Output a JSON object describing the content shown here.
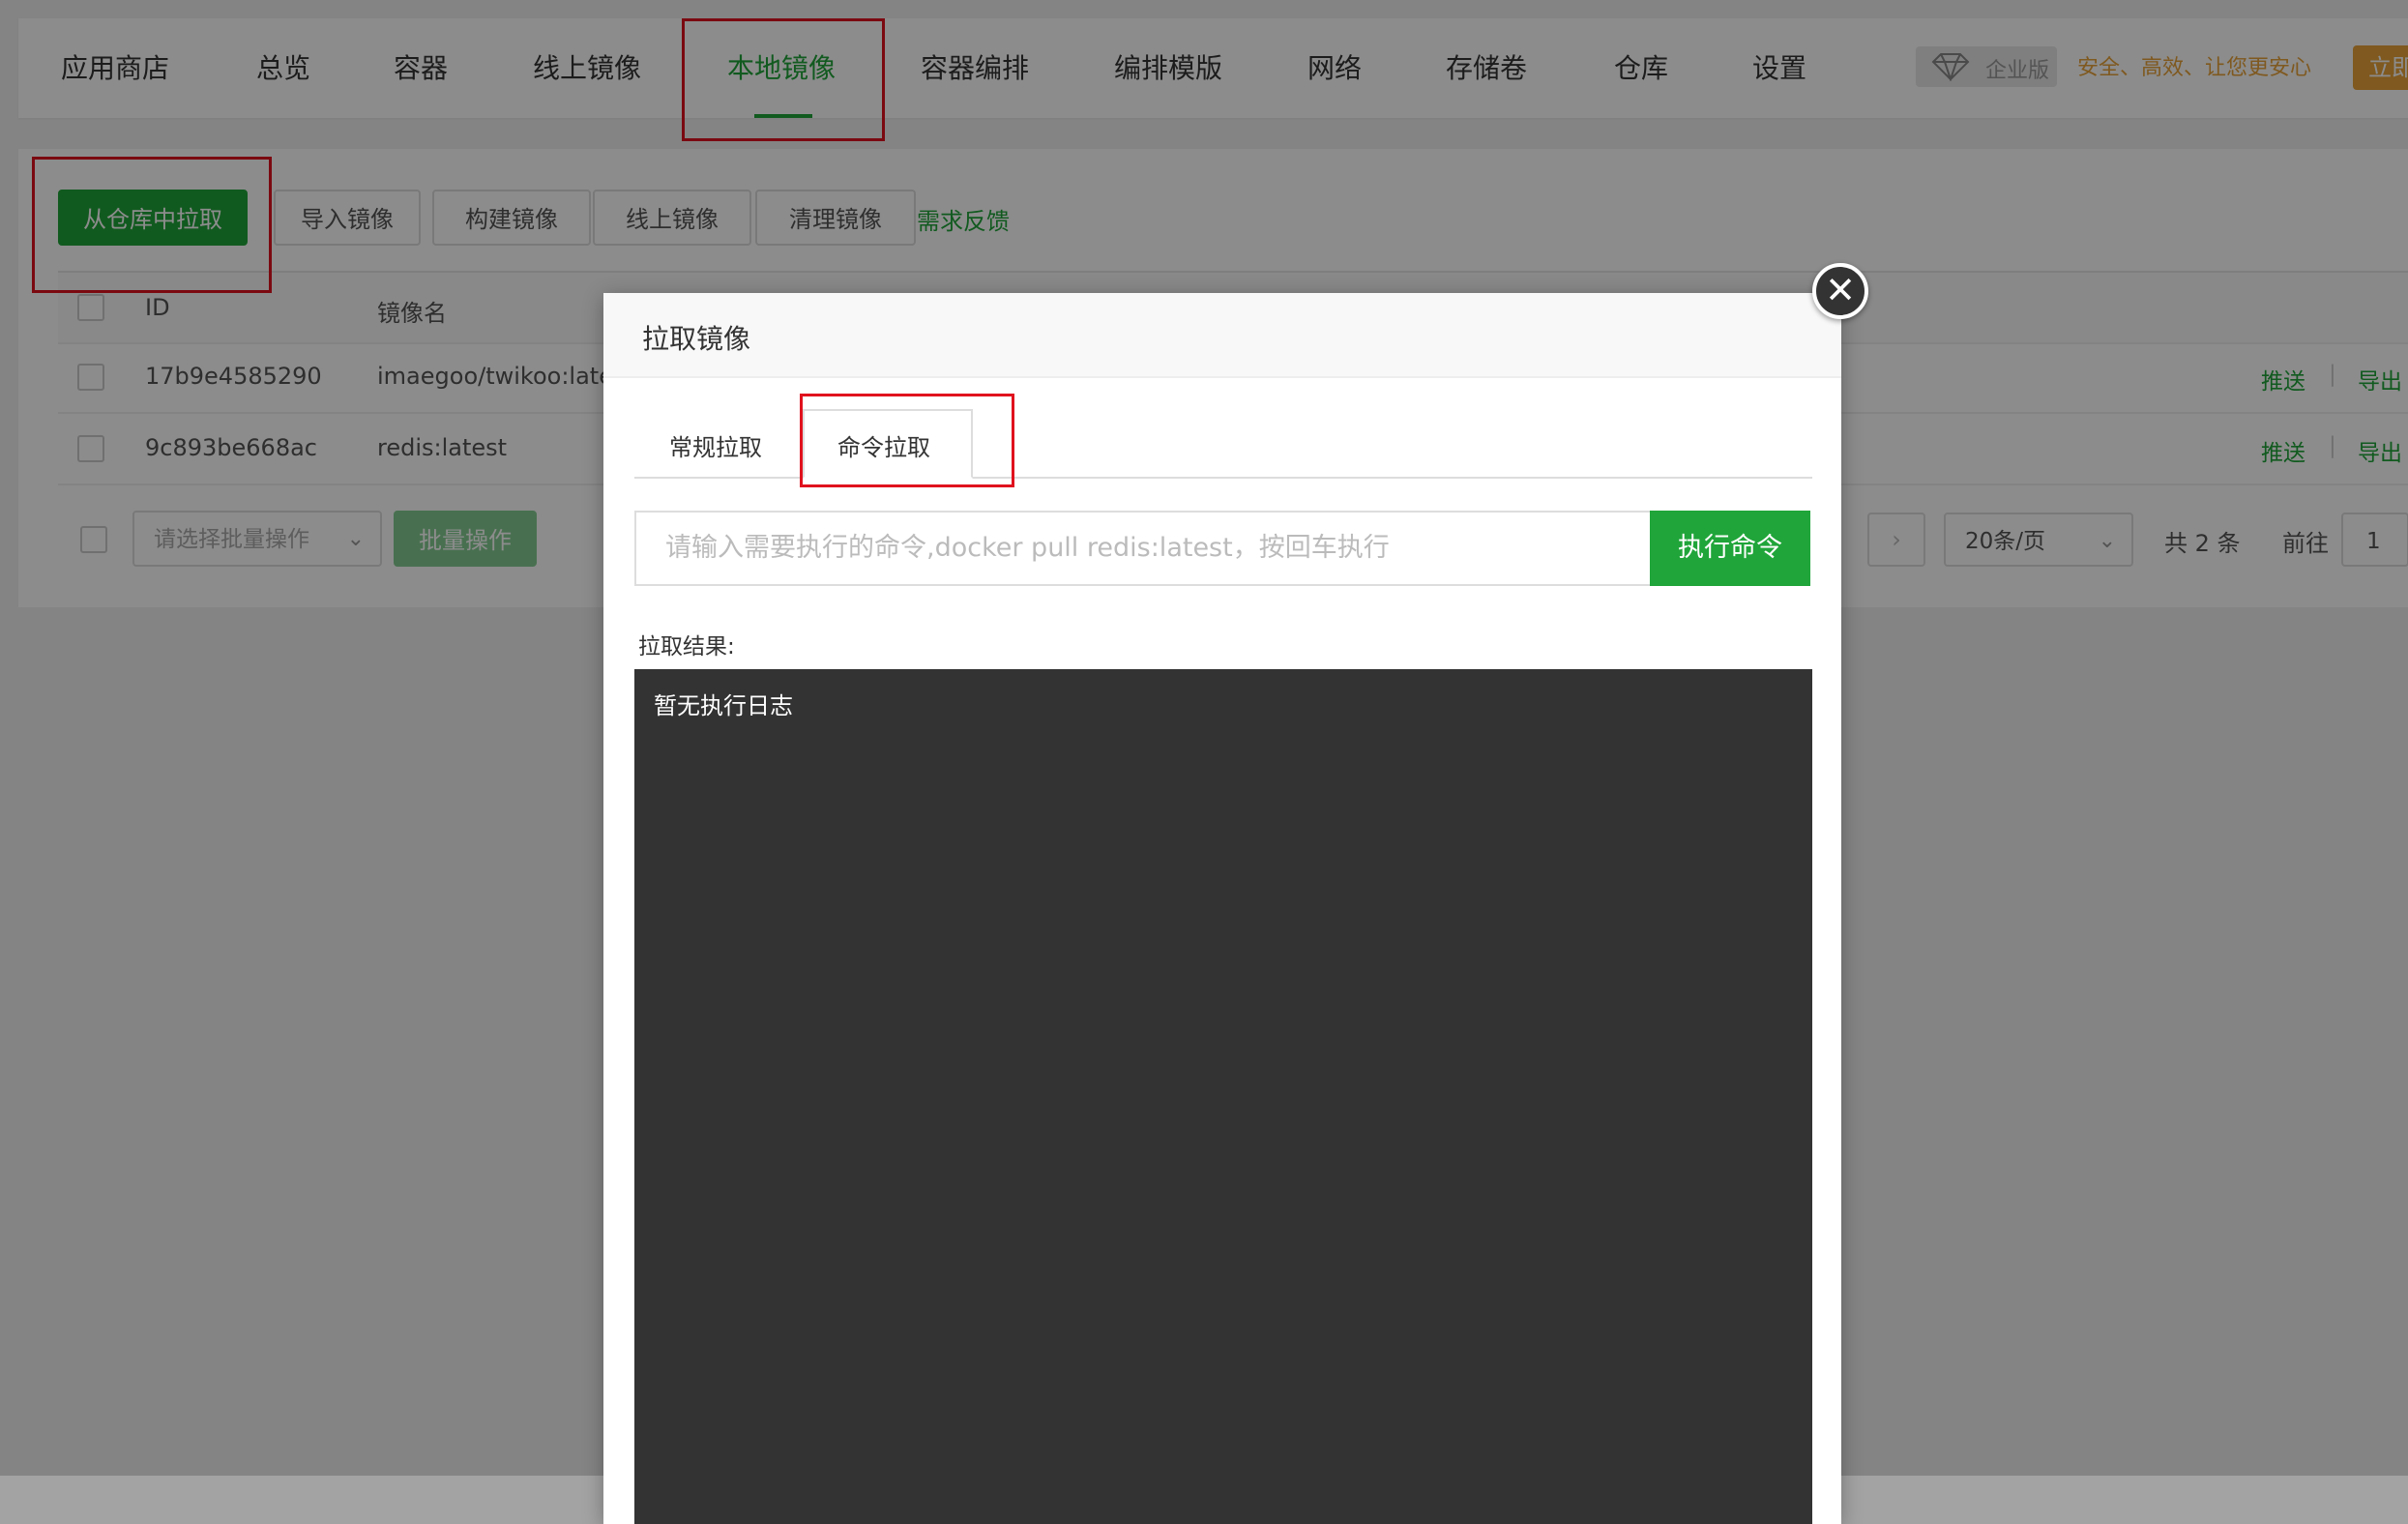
{
  "nav": {
    "items": [
      "应用商店",
      "总览",
      "容器",
      "线上镜像",
      "本地镜像",
      "容器编排",
      "编排模版",
      "网络",
      "存储卷",
      "仓库",
      "设置"
    ],
    "active_index": 4,
    "enterprise_badge": "企业版",
    "slogan": "安全、高效、让您更安心",
    "buy_button": "立即"
  },
  "toolbar": {
    "pull_from_repo": "从仓库中拉取",
    "import_image": "导入镜像",
    "build_image": "构建镜像",
    "online_image": "线上镜像",
    "clean_image": "清理镜像",
    "feedback": "需求反馈"
  },
  "table": {
    "headers": {
      "id": "ID",
      "name": "镜像名"
    },
    "rows": [
      {
        "id": "17b9e4585290",
        "name": "imaegoo/twikoo:lates",
        "push": "推送",
        "export": "导出"
      },
      {
        "id": "9c893be668ac",
        "name": "redis:latest",
        "push": "推送",
        "export": "导出"
      }
    ]
  },
  "batch": {
    "select_placeholder": "请选择批量操作",
    "button": "批量操作"
  },
  "pagination": {
    "page_size": "20条/页",
    "total": "共 2 条",
    "goto_label": "前往",
    "goto_value": "1"
  },
  "modal": {
    "title": "拉取镜像",
    "tabs": [
      "常规拉取",
      "命令拉取"
    ],
    "active_tab": 1,
    "command_placeholder": "请输入需要执行的命令,docker pull redis:latest，按回车执行",
    "execute_button": "执行命令",
    "result_label": "拉取结果:",
    "log_empty": "暂无执行日志"
  },
  "colors": {
    "primary": "#20a53a",
    "highlight": "#e0121e",
    "accent": "#e8a23a",
    "log_bg": "#333333"
  },
  "icons": [
    "diamond-icon",
    "chevron-down-icon",
    "chevron-right-icon",
    "close-icon"
  ]
}
